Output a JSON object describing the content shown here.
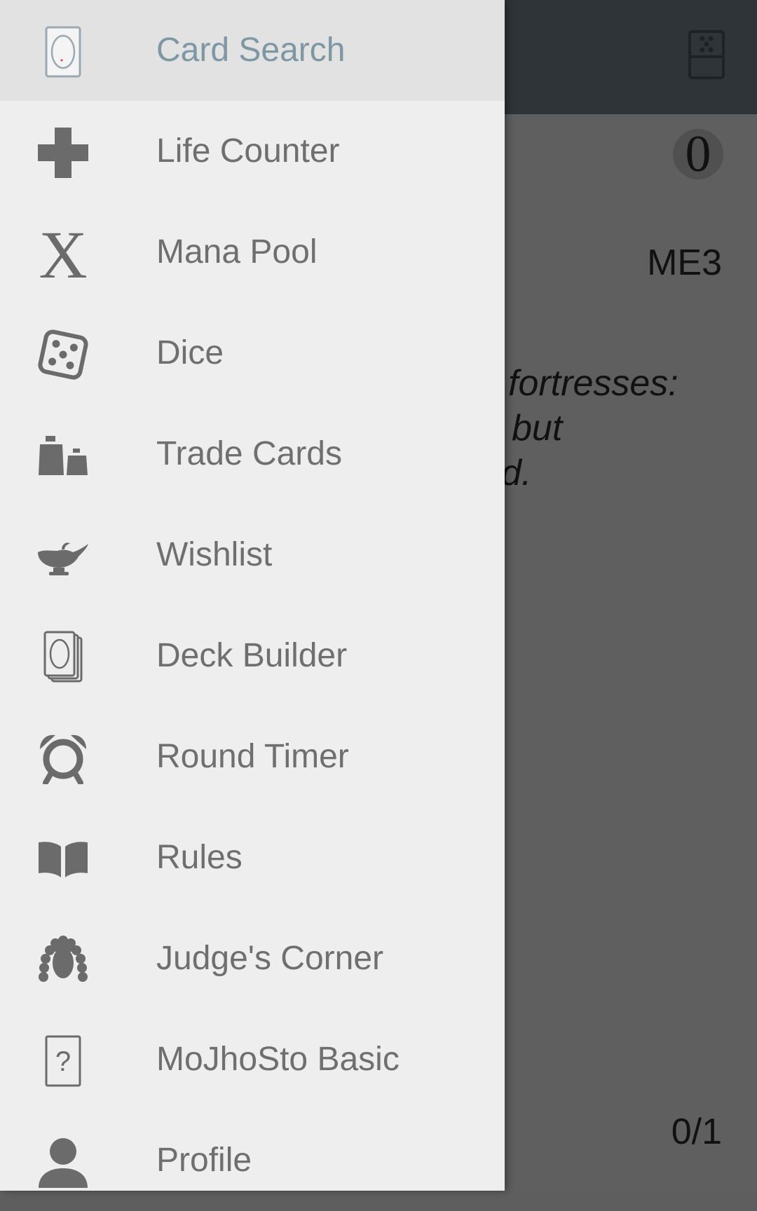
{
  "background": {
    "mana_cost": "0",
    "set_code": "ME3",
    "flavor_lines": [
      "fortresses:",
      "but",
      "d."
    ],
    "power_toughness": "0/1"
  },
  "drawer": {
    "items": [
      {
        "label": "Card Search",
        "icon": "card-icon",
        "active": true
      },
      {
        "label": "Life Counter",
        "icon": "plus-icon"
      },
      {
        "label": "Mana Pool",
        "icon": "mana-x-icon"
      },
      {
        "label": "Dice",
        "icon": "dice-icon"
      },
      {
        "label": "Trade Cards",
        "icon": "weights-icon"
      },
      {
        "label": "Wishlist",
        "icon": "genie-lamp-icon"
      },
      {
        "label": "Deck Builder",
        "icon": "card-stack-icon"
      },
      {
        "label": "Round Timer",
        "icon": "alarm-clock-icon"
      },
      {
        "label": "Rules",
        "icon": "open-book-icon"
      },
      {
        "label": "Judge's Corner",
        "icon": "judge-wig-icon"
      },
      {
        "label": "MoJhoSto Basic",
        "icon": "question-card-icon"
      },
      {
        "label": "Profile",
        "icon": "person-icon"
      }
    ]
  },
  "colors": {
    "drawer_bg": "#eeeeee",
    "active_bg": "#e2e2e2",
    "active_text": "#7e97a5",
    "text": "#6f6f6f",
    "icon": "#6b6b6b"
  }
}
